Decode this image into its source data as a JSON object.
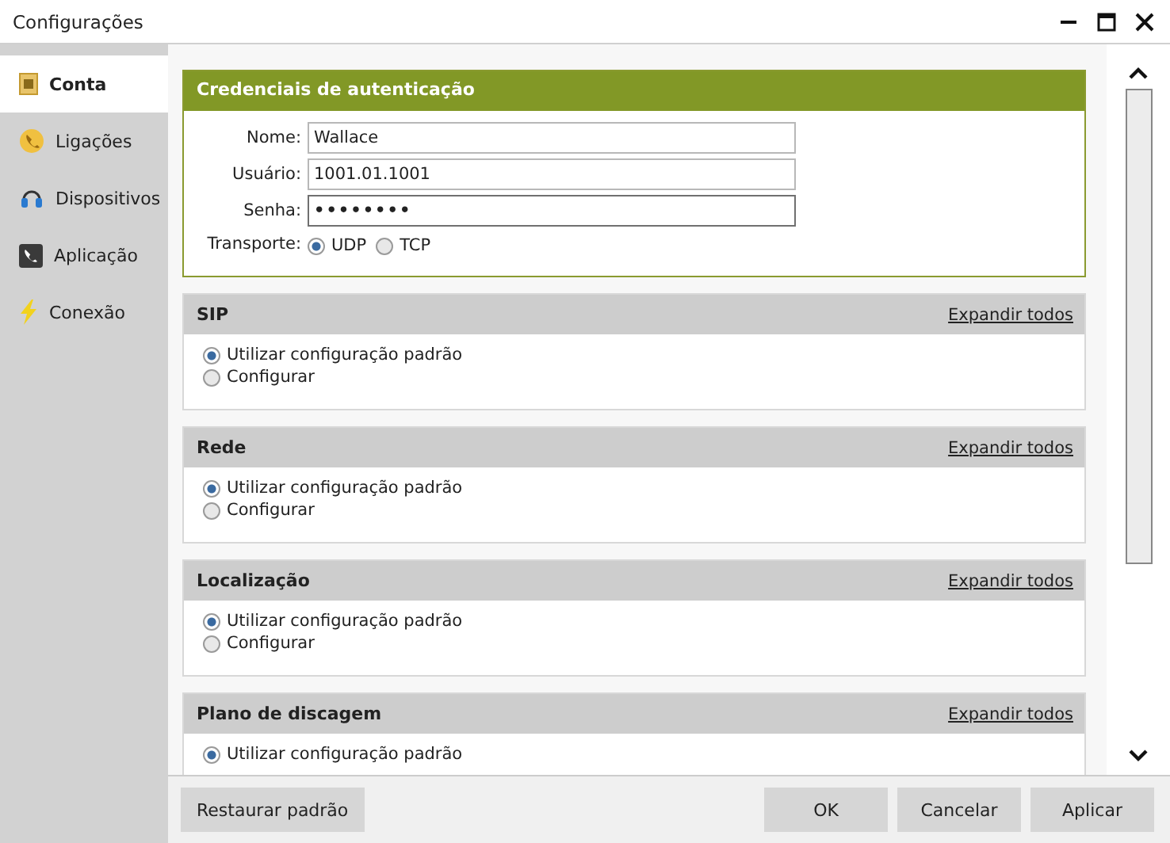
{
  "window": {
    "title": "Configurações"
  },
  "sidebar": {
    "items": [
      {
        "label": "Conta",
        "selected": true
      },
      {
        "label": "Ligações",
        "selected": false
      },
      {
        "label": "Dispositivos",
        "selected": false
      },
      {
        "label": "Aplicação",
        "selected": false
      },
      {
        "label": "Conexão",
        "selected": false
      }
    ]
  },
  "credentials": {
    "title": "Credenciais de autenticação",
    "fields": [
      {
        "label": "Nome:",
        "value": "Wallace",
        "kind": "text"
      },
      {
        "label": "Usuário:",
        "value": "1001.01.1001",
        "kind": "text"
      },
      {
        "label": "Senha:",
        "value": "••••••••",
        "kind": "password"
      }
    ],
    "transport": {
      "label": "Transporte:",
      "options": [
        {
          "label": "UDP",
          "selected": true
        },
        {
          "label": "TCP",
          "selected": false
        }
      ]
    }
  },
  "sections": [
    {
      "title": "SIP",
      "link": "Expandir todos",
      "options": [
        {
          "label": "Utilizar configuração padrão",
          "selected": true
        },
        {
          "label": "Configurar",
          "selected": false
        }
      ]
    },
    {
      "title": "Rede",
      "link": "Expandir todos",
      "options": [
        {
          "label": "Utilizar configuração padrão",
          "selected": true
        },
        {
          "label": "Configurar",
          "selected": false
        }
      ]
    },
    {
      "title": "Localização",
      "link": "Expandir todos",
      "options": [
        {
          "label": "Utilizar configuração padrão",
          "selected": true
        },
        {
          "label": "Configurar",
          "selected": false
        }
      ]
    },
    {
      "title": "Plano de discagem",
      "link": "Expandir todos",
      "options": [
        {
          "label": "Utilizar configuração padrão",
          "selected": true
        }
      ]
    }
  ],
  "buttons": {
    "left": [
      "Restaurar padrão"
    ],
    "right": [
      "OK",
      "Cancelar",
      "Aplicar"
    ]
  }
}
